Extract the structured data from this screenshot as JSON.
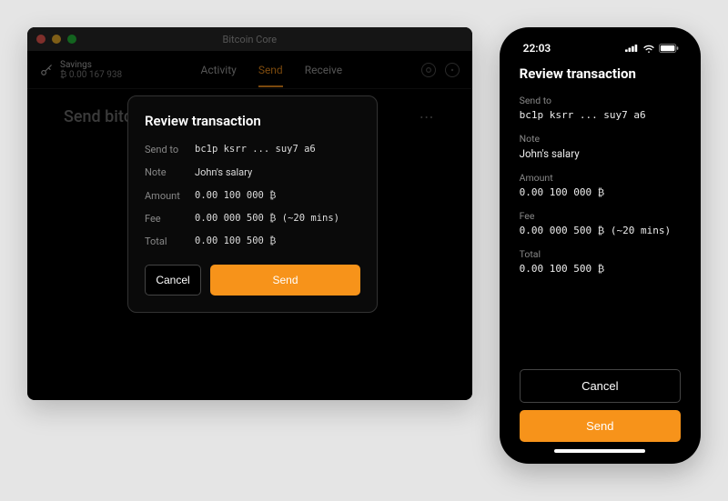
{
  "window": {
    "title": "Bitcoin Core"
  },
  "wallet": {
    "name": "Savings",
    "balance": "₿ 0.00 167 938"
  },
  "nav": {
    "activity": "Activity",
    "send": "Send",
    "receive": "Receive"
  },
  "page": {
    "title": "Send bitcoin",
    "menu": "⋯"
  },
  "modal": {
    "title": "Review transaction",
    "labels": {
      "send_to": "Send to",
      "note": "Note",
      "amount": "Amount",
      "fee": "Fee",
      "total": "Total"
    },
    "values": {
      "send_to": "bc1p ksrr ... suy7 a6",
      "note": "John's salary",
      "amount": "0.00 100 000 ₿",
      "fee": "0.00 000 500 ₿ (~20 mins)",
      "total": "0.00 100 500 ₿"
    },
    "buttons": {
      "cancel": "Cancel",
      "send": "Send"
    }
  },
  "phone": {
    "time": "22:03",
    "title": "Review transaction",
    "labels": {
      "send_to": "Send to",
      "note": "Note",
      "amount": "Amount",
      "fee": "Fee",
      "total": "Total"
    },
    "values": {
      "send_to": "bc1p ksrr ... suy7 a6",
      "note": "John's salary",
      "amount": "0.00 100 000 ₿",
      "fee": "0.00 000 500 ₿ (~20 mins)",
      "total": "0.00 100 500 ₿"
    },
    "buttons": {
      "cancel": "Cancel",
      "send": "Send"
    }
  },
  "colors": {
    "accent": "#f7931a"
  }
}
